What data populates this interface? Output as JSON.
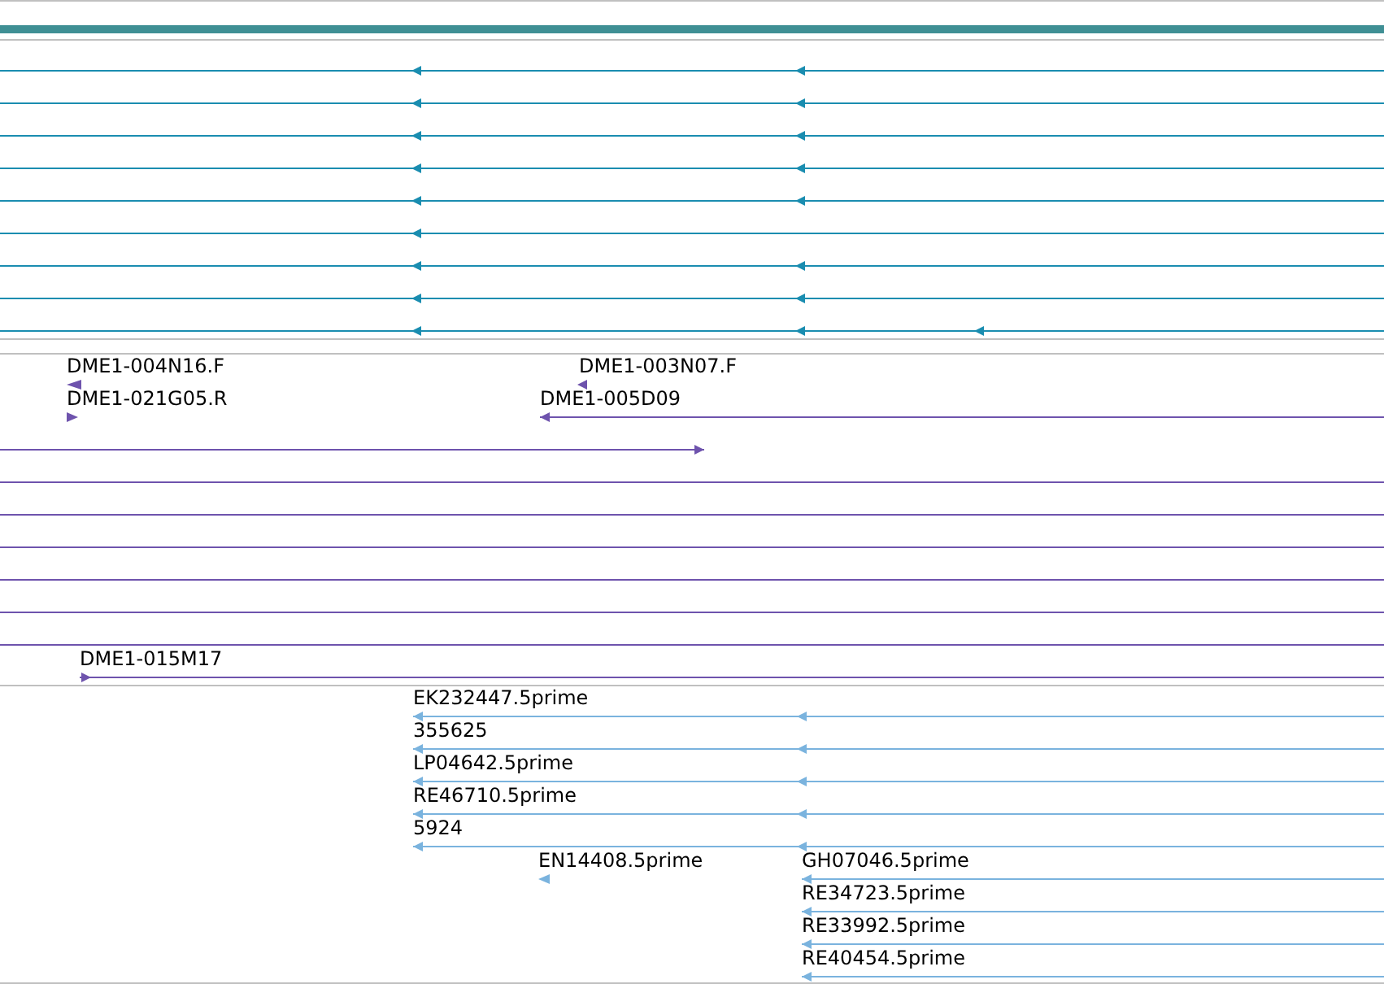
{
  "tracks": [
    {
      "color": "#1a8db0",
      "features": [
        {
          "kind": "bar"
        },
        {
          "kind": "line",
          "reverse": true
        },
        {
          "kind": "line",
          "reverse": true
        },
        {
          "kind": "line",
          "reverse": true
        },
        {
          "kind": "line",
          "reverse": true
        },
        {
          "kind": "line",
          "reverse": true
        },
        {
          "kind": "line",
          "reverse": true
        },
        {
          "kind": "line",
          "reverse": true
        },
        {
          "kind": "line",
          "reverse": true
        },
        {
          "kind": "line",
          "reverse": true
        }
      ]
    },
    {
      "color": "#6e53ad",
      "features": [
        {
          "kind": "line",
          "label": "DME1-004N16.F",
          "reverse": true
        },
        {
          "kind": "line",
          "label": "DME1-003N07.F",
          "reverse": true
        },
        {
          "kind": "line",
          "label": "DME1-021G05.R",
          "reverse": false
        },
        {
          "kind": "line",
          "label": "DME1-005D09",
          "reverse": true
        },
        {
          "kind": "line",
          "reverse": false
        },
        {
          "kind": "line"
        },
        {
          "kind": "line"
        },
        {
          "kind": "line"
        },
        {
          "kind": "line"
        },
        {
          "kind": "line"
        },
        {
          "kind": "line"
        },
        {
          "kind": "line",
          "label": "DME1-015M17",
          "reverse": false
        }
      ]
    },
    {
      "color": "#7ab3de",
      "features": [
        {
          "kind": "line",
          "label": "EK232447.5prime",
          "reverse": true
        },
        {
          "kind": "line",
          "label": "355625",
          "reverse": true
        },
        {
          "kind": "line",
          "label": "LP04642.5prime",
          "reverse": true
        },
        {
          "kind": "line",
          "label": "RE46710.5prime",
          "reverse": true
        },
        {
          "kind": "line",
          "label": "5924",
          "reverse": true
        },
        {
          "kind": "line",
          "label": "EN14408.5prime",
          "reverse": true
        },
        {
          "kind": "line",
          "label": "GH07046.5prime",
          "reverse": true
        },
        {
          "kind": "line",
          "label": "RE34723.5prime",
          "reverse": true
        },
        {
          "kind": "line",
          "label": "RE33992.5prime",
          "reverse": true
        },
        {
          "kind": "line",
          "label": "RE40454.5prime",
          "reverse": true
        }
      ]
    }
  ]
}
